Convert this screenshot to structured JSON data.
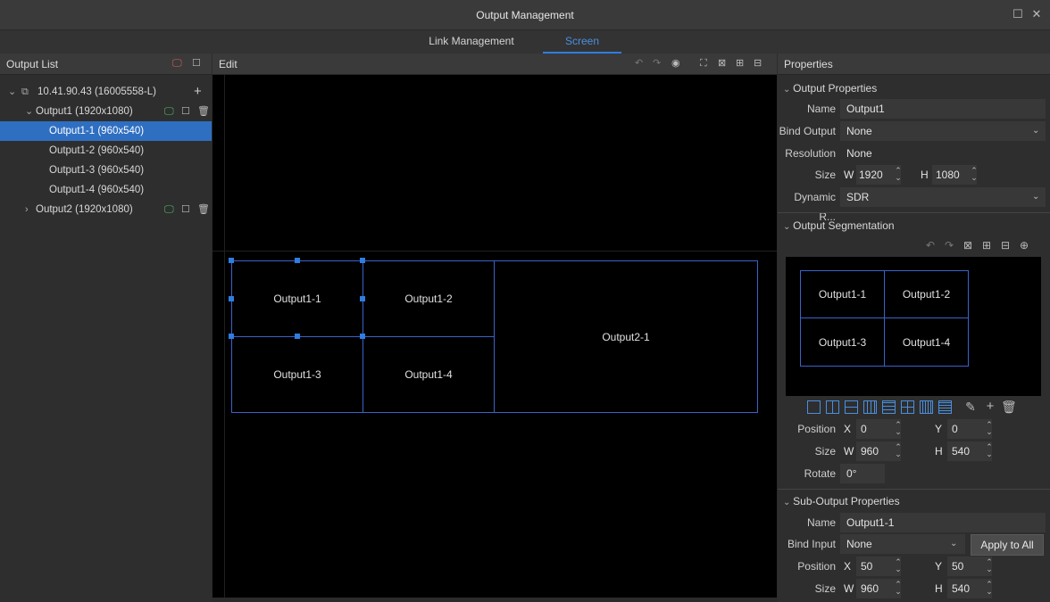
{
  "window": {
    "title": "Output Management",
    "maximize_glyph": "☐",
    "close_glyph": "✕"
  },
  "tabs": [
    {
      "label": "Link Management",
      "active": false
    },
    {
      "label": "Screen",
      "active": true
    }
  ],
  "output_list": {
    "title": "Output List",
    "device": "10.41.90.43 (16005558-L)",
    "outputs": [
      {
        "label": "Output1 (1920x1080)",
        "expanded": true,
        "children": [
          {
            "label": "Output1-1 (960x540)",
            "selected": true
          },
          {
            "label": "Output1-2 (960x540)",
            "selected": false
          },
          {
            "label": "Output1-3 (960x540)",
            "selected": false
          },
          {
            "label": "Output1-4 (960x540)",
            "selected": false
          }
        ]
      },
      {
        "label": "Output2 (1920x1080)",
        "expanded": false,
        "children": []
      }
    ]
  },
  "edit": {
    "title": "Edit",
    "boxes": [
      "Output1-1",
      "Output1-2",
      "Output1-3",
      "Output1-4",
      "Output2-1"
    ]
  },
  "properties": {
    "title": "Properties",
    "output_properties": {
      "header": "Output Properties",
      "name_label": "Name",
      "name_value": "Output1",
      "bind_output_label": "Bind Output",
      "bind_output_value": "None",
      "resolution_label": "Resolution",
      "resolution_value": "None",
      "size_label": "Size",
      "w_label": "W",
      "w_value": "1920",
      "h_label": "H",
      "h_value": "1080",
      "dynamic_label": "Dynamic R...",
      "dynamic_value": "SDR"
    },
    "segmentation": {
      "header": "Output Segmentation",
      "cells": [
        "Output1-1",
        "Output1-2",
        "Output1-3",
        "Output1-4"
      ],
      "position_label": "Position",
      "x_label": "X",
      "x_value": "0",
      "y_label": "Y",
      "y_value": "0",
      "size_label": "Size",
      "w_label": "W",
      "w_value": "960",
      "h_label": "H",
      "h_value": "540",
      "rotate_label": "Rotate",
      "rotate_value": "0°"
    },
    "sub_output": {
      "header": "Sub-Output Properties",
      "name_label": "Name",
      "name_value": "Output1-1",
      "bind_input_label": "Bind Input",
      "bind_input_value": "None",
      "apply_label": "Apply to All",
      "position_label": "Position",
      "x_label": "X",
      "x_value": "50",
      "y_label": "Y",
      "y_value": "50",
      "size_label": "Size",
      "w_label": "W",
      "w_value": "960",
      "h_label": "H",
      "h_value": "540"
    }
  },
  "colors": {
    "accent": "#2f7de1",
    "selection": "#2f6fc2",
    "green_icon": "#4fc36a",
    "box_border": "#3a62c9"
  }
}
